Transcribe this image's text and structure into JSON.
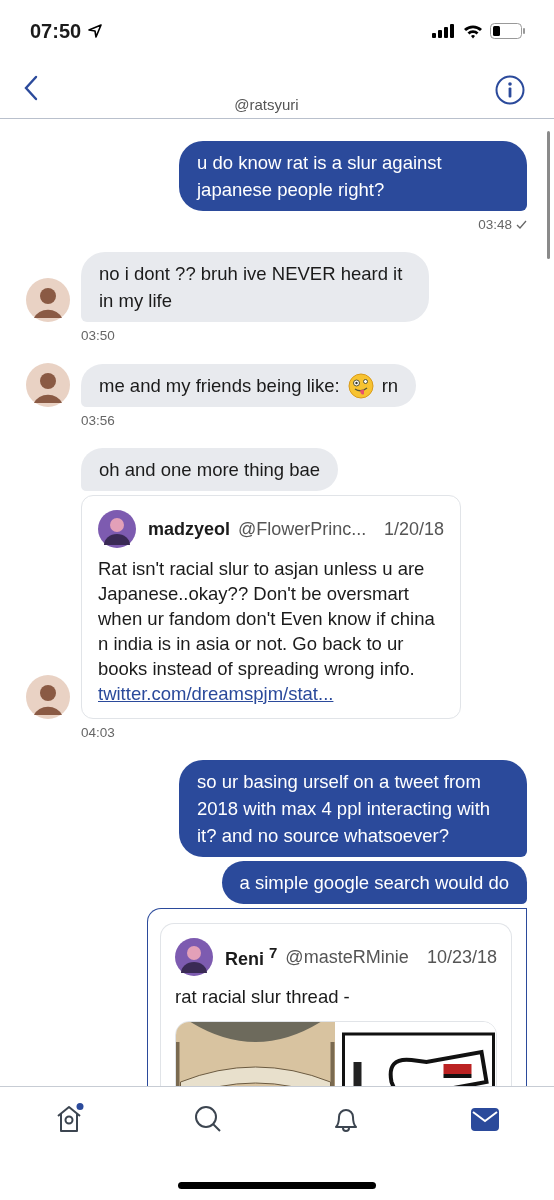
{
  "status_bar": {
    "time": "07:50"
  },
  "header": {
    "title": "@ratsyuri"
  },
  "messages": [
    {
      "outgoing": true,
      "kind": "text",
      "text": "u do know rat is a slur against japanese people right?",
      "time": "03:48",
      "read": true
    },
    {
      "outgoing": false,
      "kind": "text",
      "text": "no i dont ?? bruh ive NEVER heard it in my life",
      "avatar": true,
      "time": "03:50"
    },
    {
      "outgoing": false,
      "kind": "segments",
      "segments": [
        {
          "kind": "text",
          "text": "me and my friends being like:"
        },
        {
          "kind": "emoji"
        },
        {
          "kind": "text",
          "text": "rn"
        }
      ],
      "avatar": true,
      "time": "03:56"
    },
    {
      "outgoing": false,
      "kind": "text",
      "text": "oh and one more thing bae",
      "avatar": false
    },
    {
      "outgoing": false,
      "kind": "tweet",
      "tweet": {
        "author": "madzyeol",
        "handle": "@FlowerPrinc...",
        "date": "1/20/18",
        "text": "Rat isn't racial slur to asjan unless u are Japanese..okay?? Don't be oversmart when ur fandom don't Even know if china n india is in asia or not. Go back to ur books instead of spreading wrong info.",
        "link": "twitter.com/dreamspjm/stat..."
      },
      "avatar": true,
      "time": "04:03"
    },
    {
      "outgoing": true,
      "kind": "text",
      "text": "so ur basing urself on a tweet from 2018 with max 4 ppl interacting with it? and no source whatsoever?"
    },
    {
      "outgoing": true,
      "kind": "text",
      "text": "a simple google search would do"
    },
    {
      "outgoing": true,
      "kind": "tweet",
      "tweet": {
        "author": "Reni $^{7}$",
        "handle": "@masteRMinie",
        "date": "10/23/18",
        "text": "rat racial slur thread -"
      }
    }
  ],
  "tab_bar": [
    {
      "kind": "home",
      "selected": false,
      "badge": true
    },
    {
      "kind": "search",
      "selected": false,
      "badge": false
    },
    {
      "kind": "notifications",
      "selected": false,
      "badge": false
    },
    {
      "kind": "messages",
      "selected": true,
      "badge": false
    }
  ]
}
